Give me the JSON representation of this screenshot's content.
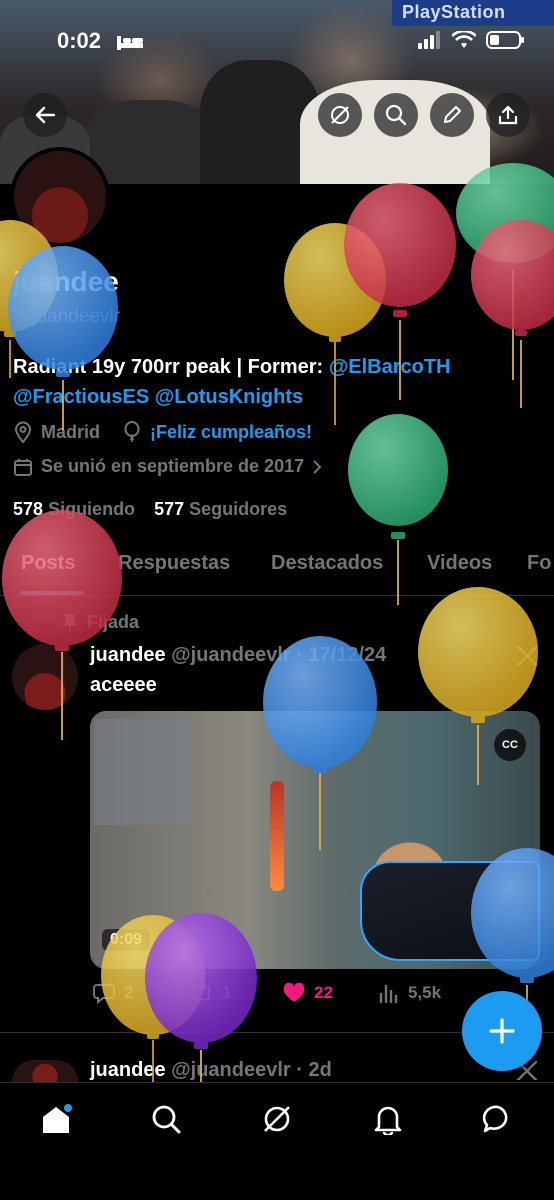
{
  "status_bar": {
    "time": "0:02"
  },
  "banner": {
    "sign_text": "PlayStation"
  },
  "profile": {
    "display_name": "juandee",
    "handle": "@juandeevlr",
    "bio_text": "Radiant 19y 700rr peak | Former: ",
    "bio_mention_1": "@ElBarcoTH",
    "bio_mention_2": "@FractiousES",
    "bio_mention_3": "@LotusKnights",
    "location": "Madrid",
    "birthday": "¡Feliz cumpleaños!",
    "joined": "Se unió en septiembre de 2017",
    "following_count": "578",
    "following_label": "Siguiendo",
    "followers_count": "577",
    "followers_label": "Seguidores"
  },
  "tabs": [
    "Posts",
    "Respuestas",
    "Destacados",
    "Videos",
    "Fo"
  ],
  "posts": [
    {
      "pinned_label": "Fijada",
      "name": "juandee",
      "handle_date": "@juandeevlr · 17/12/24",
      "text": "aceeee",
      "video_time": "0:09",
      "cc_label": "CC",
      "replies": "2",
      "reposts": "1",
      "likes": "22",
      "views": "5,5k"
    },
    {
      "name": "juandee",
      "handle_date": "@juandeevlr · 2d"
    }
  ],
  "colors": {
    "background": "#000000",
    "accent": "#1d9bf0",
    "like": "#f91880",
    "muted": "#71767b",
    "balloon_yellow": "#e8c23a",
    "balloon_red": "#d9384f",
    "balloon_blue": "#3f8fe6",
    "balloon_green": "#3dc487",
    "balloon_purple": "#8a3ad6"
  },
  "icons": {
    "back": "arrow-left-icon",
    "grok": "grok-icon",
    "search": "search-icon",
    "edit": "pencil-icon",
    "share": "share-icon",
    "location": "location-pin-icon",
    "birthday": "balloon-outline-icon",
    "calendar": "calendar-icon",
    "pin": "pin-icon",
    "x_logo": "x-logo-icon",
    "fab": "plus-icon",
    "nav": [
      "home-icon",
      "search-icon",
      "grok-icon",
      "bell-icon",
      "messages-icon"
    ]
  }
}
